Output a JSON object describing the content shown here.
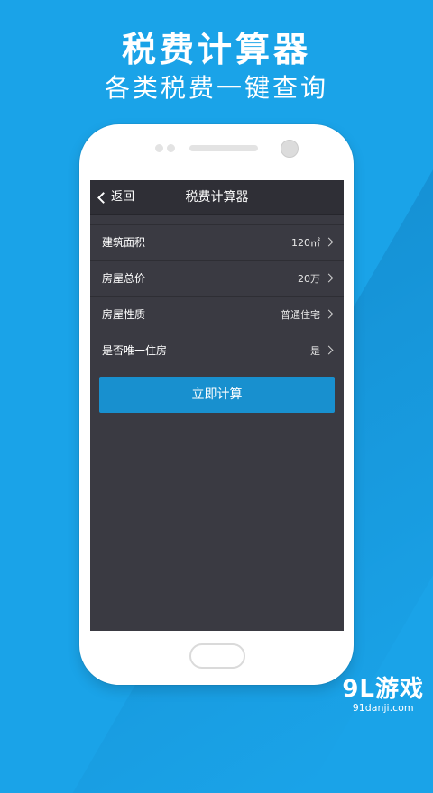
{
  "promo": {
    "headline": "税费计算器",
    "subheadline": "各类税费一键查询"
  },
  "app": {
    "nav": {
      "back_label": "返回",
      "title": "税费计算器"
    },
    "fields": [
      {
        "label": "建筑面积",
        "value": "120㎡"
      },
      {
        "label": "房屋总价",
        "value": "20万"
      },
      {
        "label": "房屋性质",
        "value": "普通住宅"
      },
      {
        "label": "是否唯一住房",
        "value": "是"
      }
    ],
    "calculate_button": "立即计算"
  },
  "watermark": {
    "logo": "9L游戏",
    "url": "91danji.com"
  },
  "colors": {
    "background": "#1aa3e8",
    "screen": "#3a3a42",
    "accent": "#1890cf"
  }
}
